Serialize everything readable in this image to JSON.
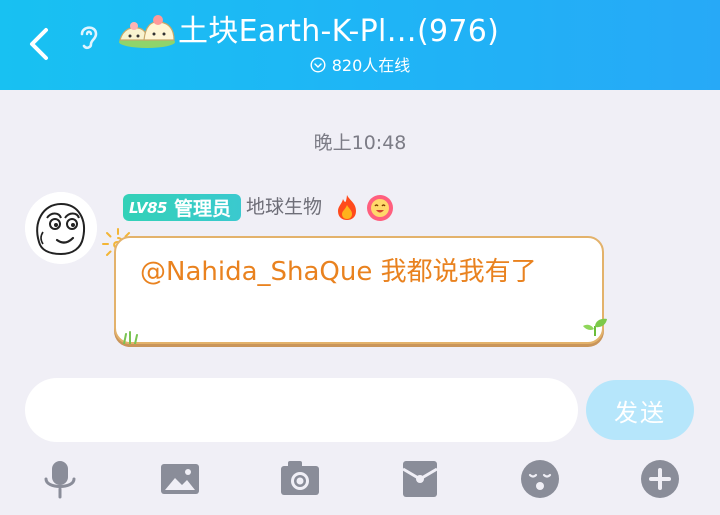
{
  "header": {
    "title": "土块Earth-K-Pl…(976)",
    "online": "820人在线",
    "back_icon": "chevron-left-icon",
    "ear_icon": "ear-icon",
    "group_emoji": "dumplings-emoji-icon",
    "bg_color": "#1cb9f5"
  },
  "chat": {
    "timestamp": "晚上10:48",
    "message": {
      "level": "LV85",
      "role": "管理员",
      "nickname": "地球生物",
      "text": "@Nahida_ShaQue 我都说我有了",
      "badges": [
        "fire-icon",
        "flower-face-icon"
      ]
    }
  },
  "composer": {
    "input_value": "",
    "input_placeholder": "",
    "send_label": "发送"
  },
  "toolbar": [
    "microphone-icon",
    "image-icon",
    "camera-icon",
    "red-packet-icon",
    "emoji-icon",
    "plus-icon"
  ]
}
